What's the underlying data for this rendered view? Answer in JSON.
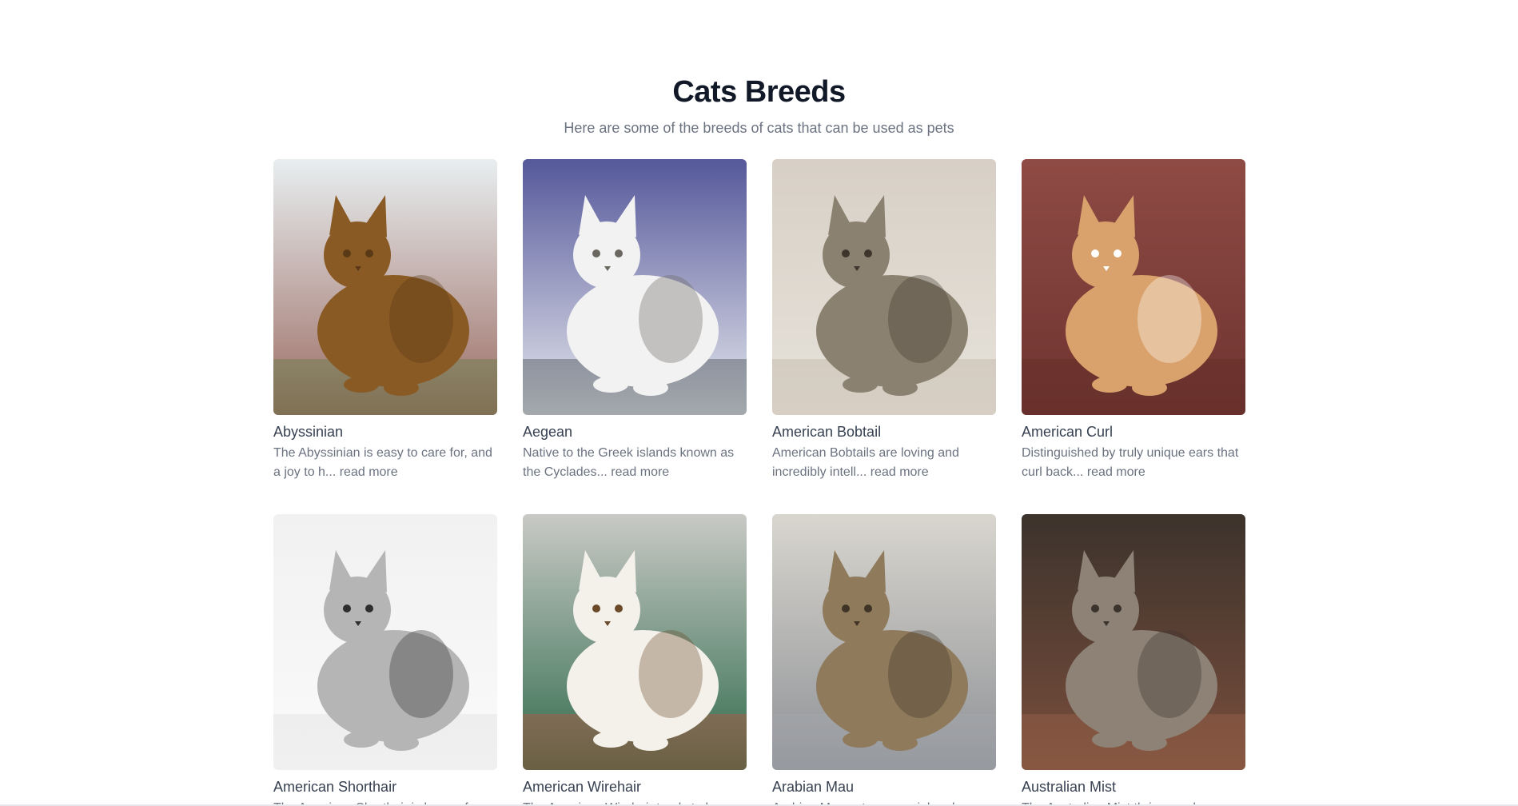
{
  "header": {
    "title": "Cats Breeds",
    "subtitle": "Here are some of the breeds of cats that can be used as pets"
  },
  "read_more_label": "read more",
  "breeds": [
    {
      "name": "Abyssinian",
      "description": "The Abyssinian is easy to care for, and a joy to h...",
      "photo": "abyssinian-cat-photo",
      "colors": {
        "bg_top": "#e8eef0",
        "bg_bottom": "#9b6b62",
        "cat": "#8a5a24",
        "cat_dark": "#5a3a16",
        "accent": "#4f7a3a"
      }
    },
    {
      "name": "Aegean",
      "description": "Native to the Greek islands known as the Cyclades...",
      "photo": "aegean-cat-photo",
      "colors": {
        "bg_top": "#55589a",
        "bg_bottom": "#e7e9ee",
        "cat": "#f2f2f2",
        "cat_dark": "#6b6760",
        "accent": "#243030"
      }
    },
    {
      "name": "American Bobtail",
      "description": "American Bobtails are loving and incredibly intell...",
      "photo": "american-bobtail-cat-photo",
      "colors": {
        "bg_top": "#d8d0c6",
        "bg_bottom": "#e6e2da",
        "cat": "#8b8170",
        "cat_dark": "#3e362c",
        "accent": "#b9ad9c"
      }
    },
    {
      "name": "American Curl",
      "description": "Distinguished by truly unique ears that curl back...",
      "photo": "american-curl-cat-photo",
      "colors": {
        "bg_top": "#8f4a44",
        "bg_bottom": "#6e3430",
        "cat": "#d9a26c",
        "cat_dark": "#ffffff",
        "accent": "#5e2a26"
      }
    },
    {
      "name": "American Shorthair",
      "description": "The American Shorthair is known for its...",
      "photo": "american-shorthair-cat-photo",
      "colors": {
        "bg_top": "#f1f1f1",
        "bg_bottom": "#fafafa",
        "cat": "#b5b5b5",
        "cat_dark": "#2e2e2e",
        "accent": "#dcdcdc"
      }
    },
    {
      "name": "American Wirehair",
      "description": "The American Wirehair tends to be a...",
      "photo": "american-wirehair-cat-photo",
      "colors": {
        "bg_top": "#c9c9c6",
        "bg_bottom": "#2f6b4b",
        "cat": "#f4f1ea",
        "cat_dark": "#6b4a2a",
        "accent": "#d84a36"
      }
    },
    {
      "name": "Arabian Mau",
      "description": "Arabian Mau cats are social and...",
      "photo": "arabian-mau-cat-photo",
      "colors": {
        "bg_top": "#d9d6cf",
        "bg_bottom": "#8e9196",
        "cat": "#8f7a5c",
        "cat_dark": "#3f3426",
        "accent": "#a7aab0"
      }
    },
    {
      "name": "Australian Mist",
      "description": "The Australian Mist thrives on human...",
      "photo": "australian-mist-cat-photo",
      "colors": {
        "bg_top": "#3c332c",
        "bg_bottom": "#7a4e3c",
        "cat": "#8d8275",
        "cat_dark": "#3b342e",
        "accent": "#a26a4e"
      }
    }
  ]
}
